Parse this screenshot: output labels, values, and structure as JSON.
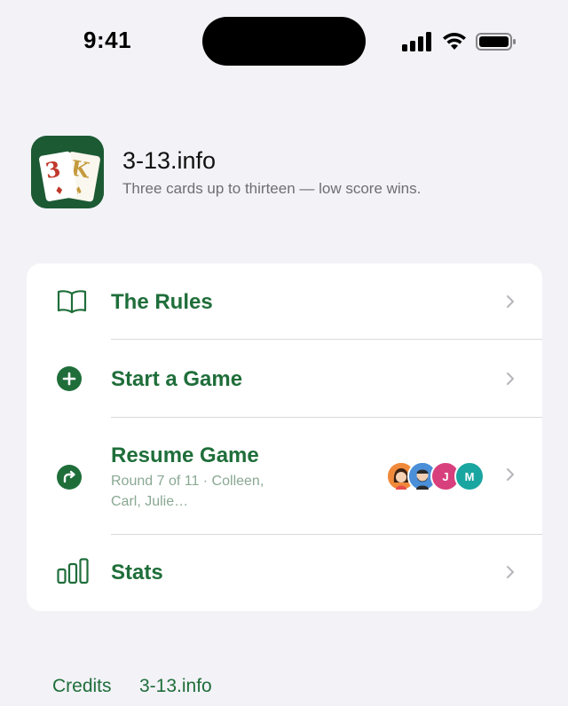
{
  "status_bar": {
    "time": "9:41"
  },
  "app": {
    "title": "3-13.info",
    "subtitle": "Three cards up to thirteen — low score wins.",
    "icon_cards": {
      "front": "3",
      "back": "K"
    }
  },
  "menu": {
    "rules": {
      "label": "The Rules",
      "icon": "book-icon"
    },
    "start": {
      "label": "Start a Game",
      "icon": "plus-circle-icon"
    },
    "resume": {
      "label": "Resume Game",
      "icon": "resume-arrow-icon",
      "detail": "Round 7 of 11 · Colleen, Carl, Julie…",
      "avatars": [
        {
          "initial": "",
          "color": "#f08a3a",
          "kind": "woman-avatar"
        },
        {
          "initial": "",
          "color": "#4a8fd8",
          "kind": "man-avatar"
        },
        {
          "initial": "J",
          "color": "#d8407d",
          "kind": "initial-avatar"
        },
        {
          "initial": "M",
          "color": "#1aa6a0",
          "kind": "initial-avatar"
        }
      ]
    },
    "stats": {
      "label": "Stats",
      "icon": "bar-chart-icon"
    }
  },
  "footer": {
    "credits": "Credits",
    "site": "3-13.info"
  },
  "colors": {
    "accent": "#1f6e3a",
    "icon_bg": "#1c5a34",
    "background": "#f2f2f7"
  }
}
